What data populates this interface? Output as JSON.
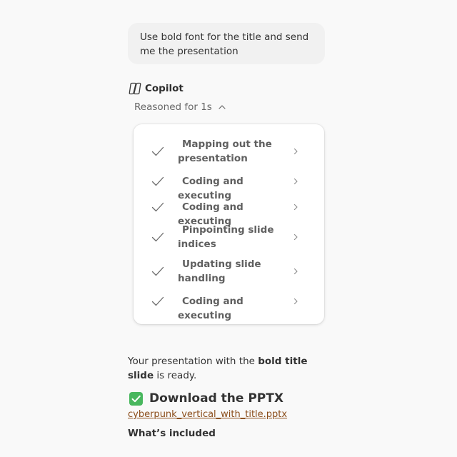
{
  "user_message": {
    "text": "Use bold font for the title and send me the presentation"
  },
  "assistant": {
    "name": "Copilot",
    "reasoning_toggle": "Reasoned for 1s",
    "steps": [
      {
        "label": "Mapping out the presentation"
      },
      {
        "label": "Coding and executing"
      },
      {
        "label": "Coding and executing"
      },
      {
        "label": "Pinpointing slide indices"
      },
      {
        "label": "Updating slide handling"
      },
      {
        "label": "Coding and executing"
      }
    ],
    "result": {
      "prefix": "Your presentation with the ",
      "bold": "bold title slide",
      "suffix": " is ready."
    },
    "download": {
      "title": "Download the PPTX",
      "file_name": "cyberpunk_vertical_with_title.pptx"
    },
    "included_heading": "What’s included"
  },
  "icons": {
    "copilot": "copilot-logo-icon",
    "step_status": "checkmark-icon",
    "step_expand": "chevron-right-icon",
    "toggle": "chevron-up-icon",
    "download": "green-check-emoji-icon"
  },
  "colors": {
    "background": "#f9f9f9",
    "user_bubble": "#f1f1f1",
    "link": "#8b4d1a",
    "check_emoji": "#48b75e"
  }
}
